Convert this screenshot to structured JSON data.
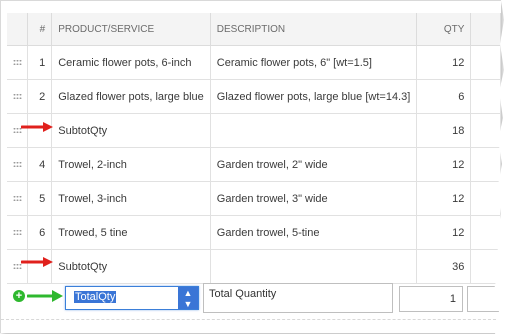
{
  "columns": {
    "number": "#",
    "product": "PRODUCT/SERVICE",
    "description": "DESCRIPTION",
    "qty": "QTY"
  },
  "rows": [
    {
      "number": "1",
      "product": "Ceramic flower pots, 6-inch",
      "description": "Ceramic flower pots, 6\" [wt=1.5]",
      "qty": "12"
    },
    {
      "number": "2",
      "product": "Glazed flower pots, large blue",
      "description": "Glazed flower pots, large blue [wt=14.3]",
      "qty": "6"
    },
    {
      "number": "",
      "product": "SubtotQty",
      "description": "",
      "qty": "18"
    },
    {
      "number": "4",
      "product": "Trowel, 2-inch",
      "description": "Garden trowel, 2\" wide",
      "qty": "12"
    },
    {
      "number": "5",
      "product": "Trowel, 3-inch",
      "description": "Garden trowel, 3\" wide",
      "qty": "12"
    },
    {
      "number": "6",
      "product": "Trowed, 5 tine",
      "description": "Garden trowel, 5-tine",
      "qty": "12"
    },
    {
      "number": "",
      "product": "SubtotQty",
      "description": "",
      "qty": "36"
    }
  ],
  "edit_row": {
    "product_selected": "TotalQty",
    "description": "Total Quantity",
    "qty": "1"
  },
  "colors": {
    "annotation_arrow_red": "#e0201c",
    "annotation_arrow_green": "#2eb82e",
    "selection_blue": "#3a75d6"
  }
}
